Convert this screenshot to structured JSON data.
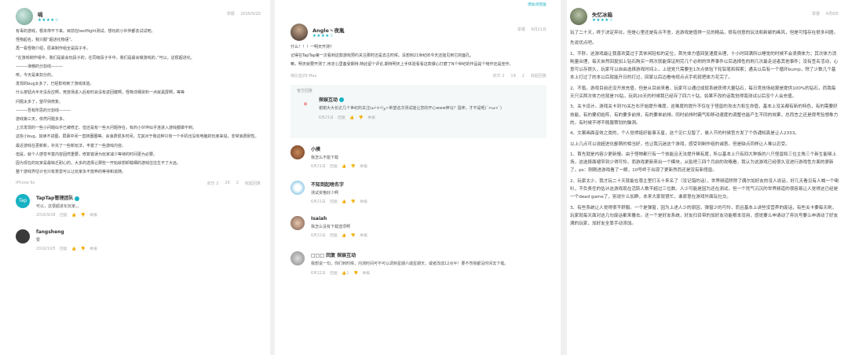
{
  "c1": {
    "user": "嗝",
    "stars": "★★★★☆",
    "meta": "举报   2016/9/20",
    "paragraphs": [
      "有毒的游戏，根本停不下来。目前在testflight测试。想玩的小伙伴都去试试吧。",
      "怪物起名，我只服“超进化物语”。",
      "再一看怪物介绍，原来制作组全是段子手。",
      "“在游戏制作组中，我们是最会玩段子的；在同级段子手中，我们是最会做游戏的。”可以，这很超进化。",
      "———滑稽的分割线———",
      "咳，今天是来扣分的。",
      "发现的bug太多了，已经影响到了游戏体验。",
      "什么按钮点半天没反应啊，竞技场进入后有时会没有返回键啊，怪物详细资料一点就黑屏啊，等等",
      "问题太多了，望尽快修复。",
      "———吾有所思的分割线———",
      "游戏第三天，依然问题多多。",
      "上次发现的一些小问题似乎已被修正。但还是有一些大问题存在，有的小伙伴似乎连进入游戏都做不到。",
      "这些小bug，如读不进图，屏幕中间一直转圈圈等。会浪费很多时间，尤其对于我这种只有一个手机也没有电脑的玩家来说，非常浪费耐性。",
      "最近游戏在更新新，补充了一些新玩法，丰富了一些游戏内容。",
      "但是，就个人感觉丰富内容固然重要，修复错误为玩家减少等待的时间更为必要。",
      "因为现在的玩家是最缺乏耐心的，大多的选择让那些一开始就想卸载细的游戏往往生不了大远。",
      "整个游戏界估计也只有意雷可以让玩家永不放弃的等待和追随。"
    ],
    "device": "iPhone 6s",
    "footer": [
      "欢乐 2",
      "26",
      "2",
      "收起回复"
    ],
    "replies": [
      {
        "name": "TapTap管理团队",
        "text": "可以，这很超进化玩家。。",
        "meta": "2016/9/28  回复  👍  👎  举报"
      },
      {
        "name": "fangsheng",
        "text": "赞",
        "meta": "2016/10/5  回复  👍  👎  举报"
      }
    ]
  },
  "c2": {
    "top_link": "添加点回复",
    "user": "Angle丶夜胤",
    "stars": "★★★★☆",
    "meta": "举报   6月21日",
    "paragraphs": [
      "什么！！！一明天开测？",
      "记得在TapTap第一次看到这款游戏预约关注那时还是去古时候。没想到21世纪的今天还能见到它的面孔。",
      "嘛，明天就要开测了,肯定心里备受期待,特此留个评论,期待明天上手体验看看这款爆心打磨了N个世纪的作品是个啥作还是佳作。"
    ],
    "device": "荷比亚Z9 Max",
    "footer": [
      "欢乐 2",
      "19",
      "2",
      "收起回复"
    ],
    "official_label": "官方回复",
    "official_name": "探娱互动",
    "official_text": "谢谢大大长达几个世纪的关注(๑•̀ㅂ•́)و✧希望这次测试能让您的开心www神马？蛋疼，才不是呢(´>ω<`)",
    "official_meta": "6月21日  回复  👍  👎  举报",
    "replies": [
      {
        "name": "小摸",
        "text": "我怎么不能下载",
        "meta": "6月21日  回复  👍  👎  举报"
      },
      {
        "name": "不知到起啥名字",
        "text": "测试资格好少啊",
        "meta": "6月21日  回复  👍  👎  举报"
      },
      {
        "name": "Isaiah",
        "text": "我怎么没有下载选项啊",
        "meta": "6月22日  回复  👍  👎  举报"
      },
      {
        "name": "□□□ 回复 探娱互动",
        "text": "我想说一句，你们到时候，内测时间可不可以调到星期六或星期天，或者改成12点半！要不然我都没时间去下载。",
        "meta": "6月22日  回复  👍1  👎  举报"
      }
    ]
  },
  "c3": {
    "user": "失忆冰箱",
    "stars": "★★★★☆",
    "meta": "举报   4月8日",
    "paragraphs": [
      "玩了二十天，终于决定弃坑，但是心里还是有点不舍，这游戏是值得一见的精品，很有创意的玩法和新颖的画风，但是可惜存在很多问题。",
      "先说优点吧。",
      "1、不肝。这游戏最让我喜欢莫过于其休闲轻松的定位，首先体力值回复速度合理，十小时回满所以睡觉的时候不会浪费体力；其次体力消耗量合理，每天自然回复加上钻石购买一两次就能保证刷完几个必刷的世界事件以后选择性的刷几次最走运者其他事件；没有签名活动，心意可以存很久，玩家可以自由选择游戏时间上，上班党只需要坐1次点体验下轮铅笔和探索；通关以后有一个循环bump，除了少数几个基本上打过了的本以后就能开日的打过，回家以后边看电视点点手机就把体力花完了。",
      "2、不氪。游戏目前还没开放充值，但是从目前来看，玩家可以通过成就系统获得大量钻石，每日竞技场结算是提供100%的钻石，而我每天只买两次体力也就是70钻，玩到20天的时候我已经存了四六十钻，如果不改的话我觉得南测试以后没个人会充值。",
      "3、关卡设计。游戏关卡到70关左右开始提升难度，这难度的提升不仅在于怪兽的攻击力和生命值，基本上没关都有新的特色，有的需要好技能，有的要初始阵，有的要多前排，有的要单前排。同时前排时霸气和移动速度的调整也能产生不同的效果，总而言之还是很考验想象力的，有时候不得不佩服策划的脑洞。",
      "4、文案画面音效之类的，个人觉得挺好能事五星，这个见仁见智了，悬人节的时候官方发了个伪诵知真是让人2333。",
      "以上几点可以说超进化鄙萌的相当好，也让我沉迷这个游戏，感受到制作组的诚意。但是缺点同样让人难以忍受。",
      "1、首先就是内容少更新慢。由于怪物都只有一个技能且无法提升稀有度，所以基本上只有四大种族的八只怪兽和三位主角三个新生能够上场，这选择面缩窄到少得可怜。而游戏更新来出一个模块，从贴吧三四个月前的攻略看，我认为这游戏已经很久没进行游戏性方面的更新了。ps：刚刚进游戏看了一眼，10号终于出现了更新然而还是没有新怪兽。",
      "2、玩家太少，我才玩二十天就能在尊主里打五十来名了（没记错的话），世界频道除除了偶尔加好友的没人说话，好几天看见有人喊一个喇叭，不负责任的估计这游戏现在活跃人数不超过三位数。人少可能是因为还在测试，但一个死气沉沉的世界频道的很容易让人觉得这已经是一个dead game了，别说什么加群，本来大家就很忙，谁原意在游戏外面玩社交。",
      "3、有些系统让人觉得很不舒服。一个是弹窗，因为上述人少的原因，弹窗少的可怜，而且基本上讲些没营养的废话，有些关卡要每天刷，玩家就每天面对这几句废话都来覆去。还一个是好友系统，好友扫目带的加好友功能根本没用，感觉要么申请动了弃坑号要么申请动了好友满的玩家，加好友全靠手动添加。"
    ]
  }
}
